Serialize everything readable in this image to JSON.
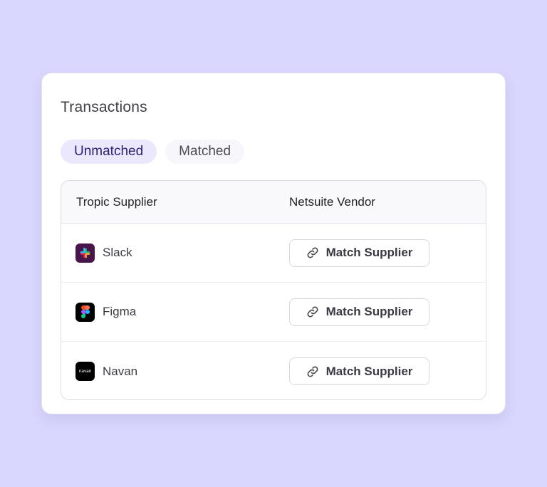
{
  "card": {
    "title": "Transactions"
  },
  "tabs": [
    {
      "label": "Unmatched",
      "active": true
    },
    {
      "label": "Matched",
      "active": false
    }
  ],
  "table": {
    "columns": [
      "Tropic Supplier",
      "Netsuite Vendor"
    ],
    "rows": [
      {
        "supplier": "Slack",
        "logo": "slack-logo",
        "logo_bg": "#4a154b",
        "action_label": "Match Supplier",
        "action_icon": "link-icon"
      },
      {
        "supplier": "Figma",
        "logo": "figma-logo",
        "logo_bg": "#000000",
        "action_label": "Match Supplier",
        "action_icon": "link-icon"
      },
      {
        "supplier": "Navan",
        "logo": "navan-logo",
        "logo_bg": "#000000",
        "logo_text": "navan",
        "action_label": "Match Supplier",
        "action_icon": "link-icon"
      }
    ]
  },
  "colors": {
    "background": "#d9d7fe",
    "active_tab_bg": "#ebe8fd",
    "active_tab_text": "#2c2170"
  }
}
